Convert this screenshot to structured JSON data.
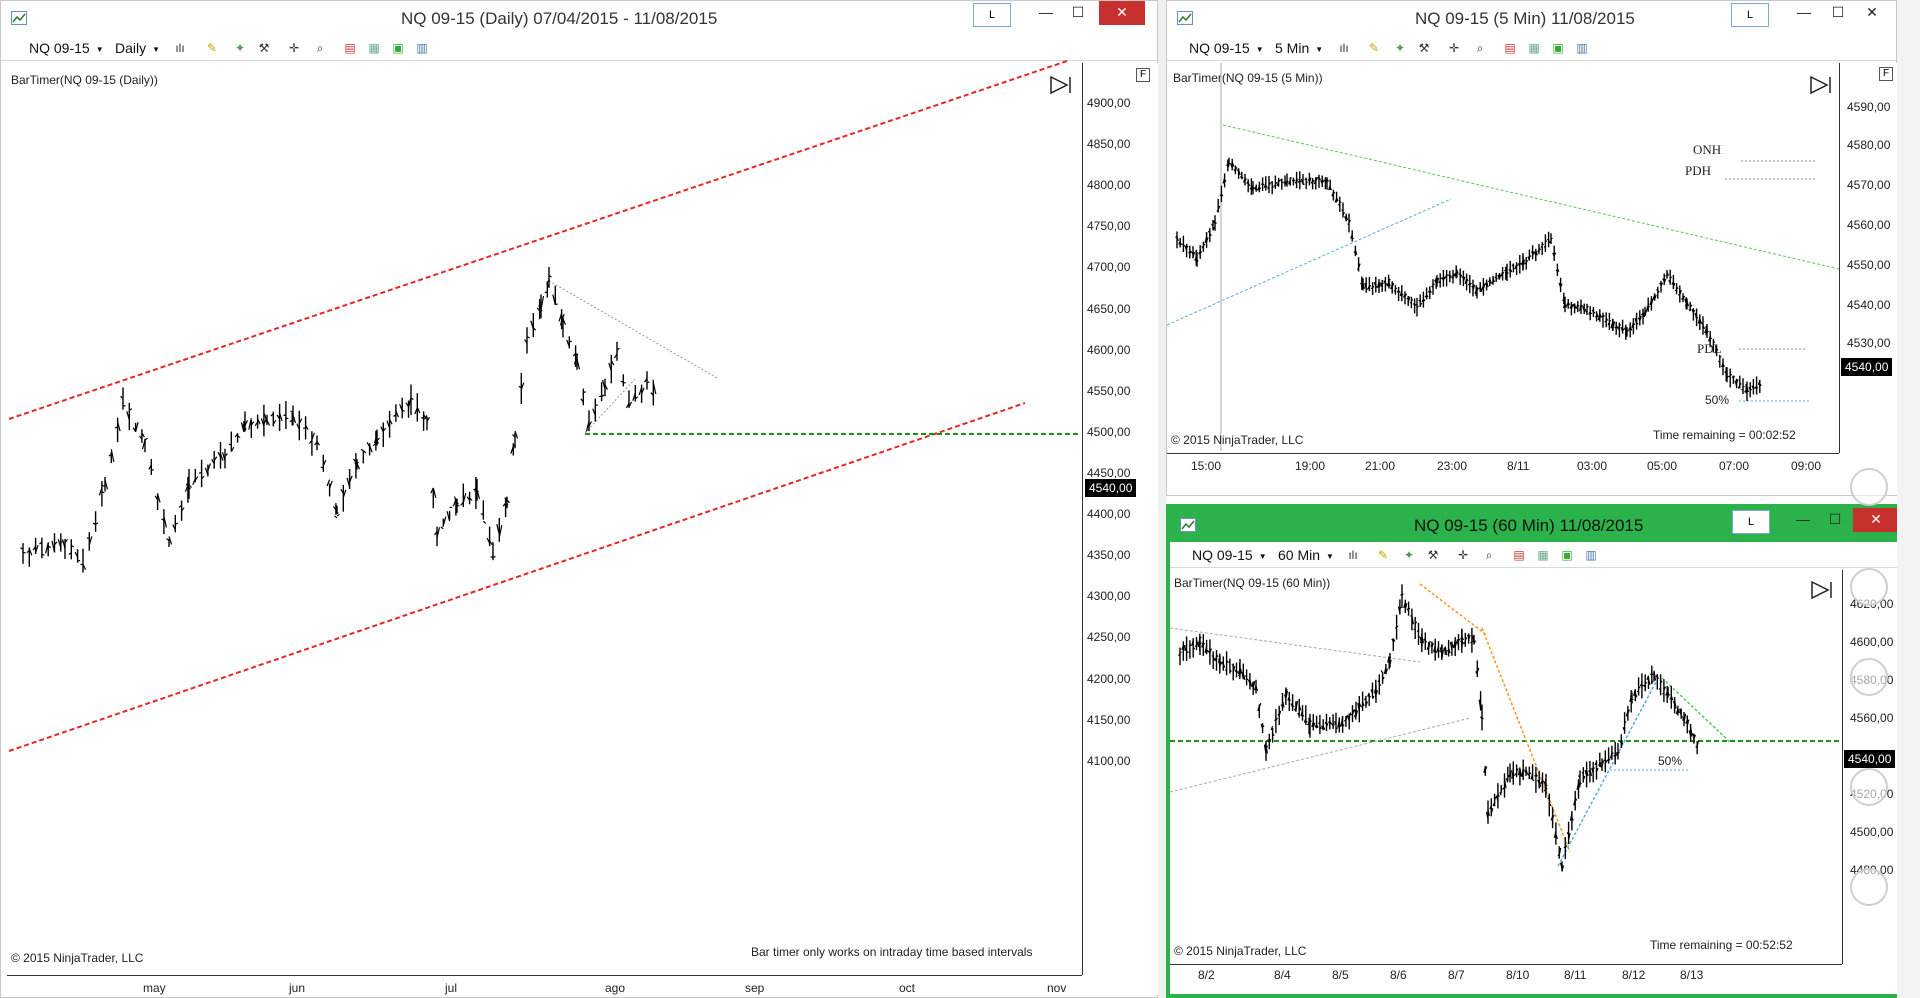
{
  "win_daily": {
    "title": "NQ 09-15 (Daily)  07/04/2015 - 11/08/2015",
    "l_label": "L",
    "instrument": "NQ 09-15",
    "interval": "Daily",
    "indicator": "BarTimer(NQ 09-15 (Daily))",
    "copyright": "© 2015 NinjaTrader, LLC",
    "note": "Bar timer only works on intraday time based intervals",
    "price_tag": "4540,00",
    "y_ticks": [
      "4900,00",
      "4850,00",
      "4800,00",
      "4750,00",
      "4700,00",
      "4650,00",
      "4600,00",
      "4550,00",
      "4500,00",
      "4450,00",
      "4400,00",
      "4350,00",
      "4300,00",
      "4250,00",
      "4200,00",
      "4150,00",
      "4100,00"
    ],
    "x_ticks": [
      "may",
      "jun",
      "jul",
      "ago",
      "sep",
      "oct",
      "nov"
    ]
  },
  "win_5min": {
    "title": "NQ 09-15 (5 Min)  11/08/2015",
    "l_label": "L",
    "instrument": "NQ 09-15",
    "interval": "5 Min",
    "indicator": "BarTimer(NQ 09-15 (5 Min))",
    "copyright": "© 2015 NinjaTrader, LLC",
    "time_remaining": "Time remaining = 00:02:52",
    "price_tag": "4540,00",
    "labels": {
      "onh": "ONH",
      "pdh": "PDH",
      "pdl": "PDL",
      "fifty": "50%"
    },
    "y_ticks": [
      "4590,00",
      "4580,00",
      "4570,00",
      "4560,00",
      "4550,00",
      "4540,00",
      "4530,00"
    ],
    "x_ticks": [
      "15:00",
      "19:00",
      "21:00",
      "23:00",
      "8/11",
      "03:00",
      "05:00",
      "07:00",
      "09:00"
    ]
  },
  "win_60min": {
    "title": "NQ 09-15 (60 Min)  11/08/2015",
    "l_label": "L",
    "instrument": "NQ 09-15",
    "interval": "60 Min",
    "indicator": "BarTimer(NQ 09-15 (60 Min))",
    "copyright": "© 2015 NinjaTrader, LLC",
    "time_remaining": "Time remaining = 00:52:52",
    "price_tag": "4540,00",
    "labels": {
      "fifty": "50%"
    },
    "y_ticks": [
      "4620,00",
      "4600,00",
      "4580,00",
      "4560,00",
      "4540,00",
      "4520,00",
      "4500,00",
      "4480,00"
    ],
    "x_ticks": [
      "8/2",
      "8/4",
      "8/5",
      "8/6",
      "8/7",
      "8/10",
      "8/11",
      "8/12",
      "8/13"
    ]
  },
  "window_buttons": {
    "minimize": "—",
    "maximize": "☐",
    "close": "✕"
  },
  "toolbar_icons": [
    "bar-style-icon",
    "pencil-icon",
    "magic-wand-icon",
    "wrench-icon",
    "crosshair-icon",
    "zoom-icon",
    "strategy-icon",
    "chart-properties-icon",
    "data-box-icon",
    "layout-icon"
  ],
  "colors": {
    "channel": "#e8262a",
    "support": "#1a8f1a",
    "active_border": "#2bb24a",
    "close_btn": "#c7312d",
    "trend_green": "#5ac85a",
    "trend_blue": "#5aaae6",
    "trend_orange": "#f39a21"
  }
}
